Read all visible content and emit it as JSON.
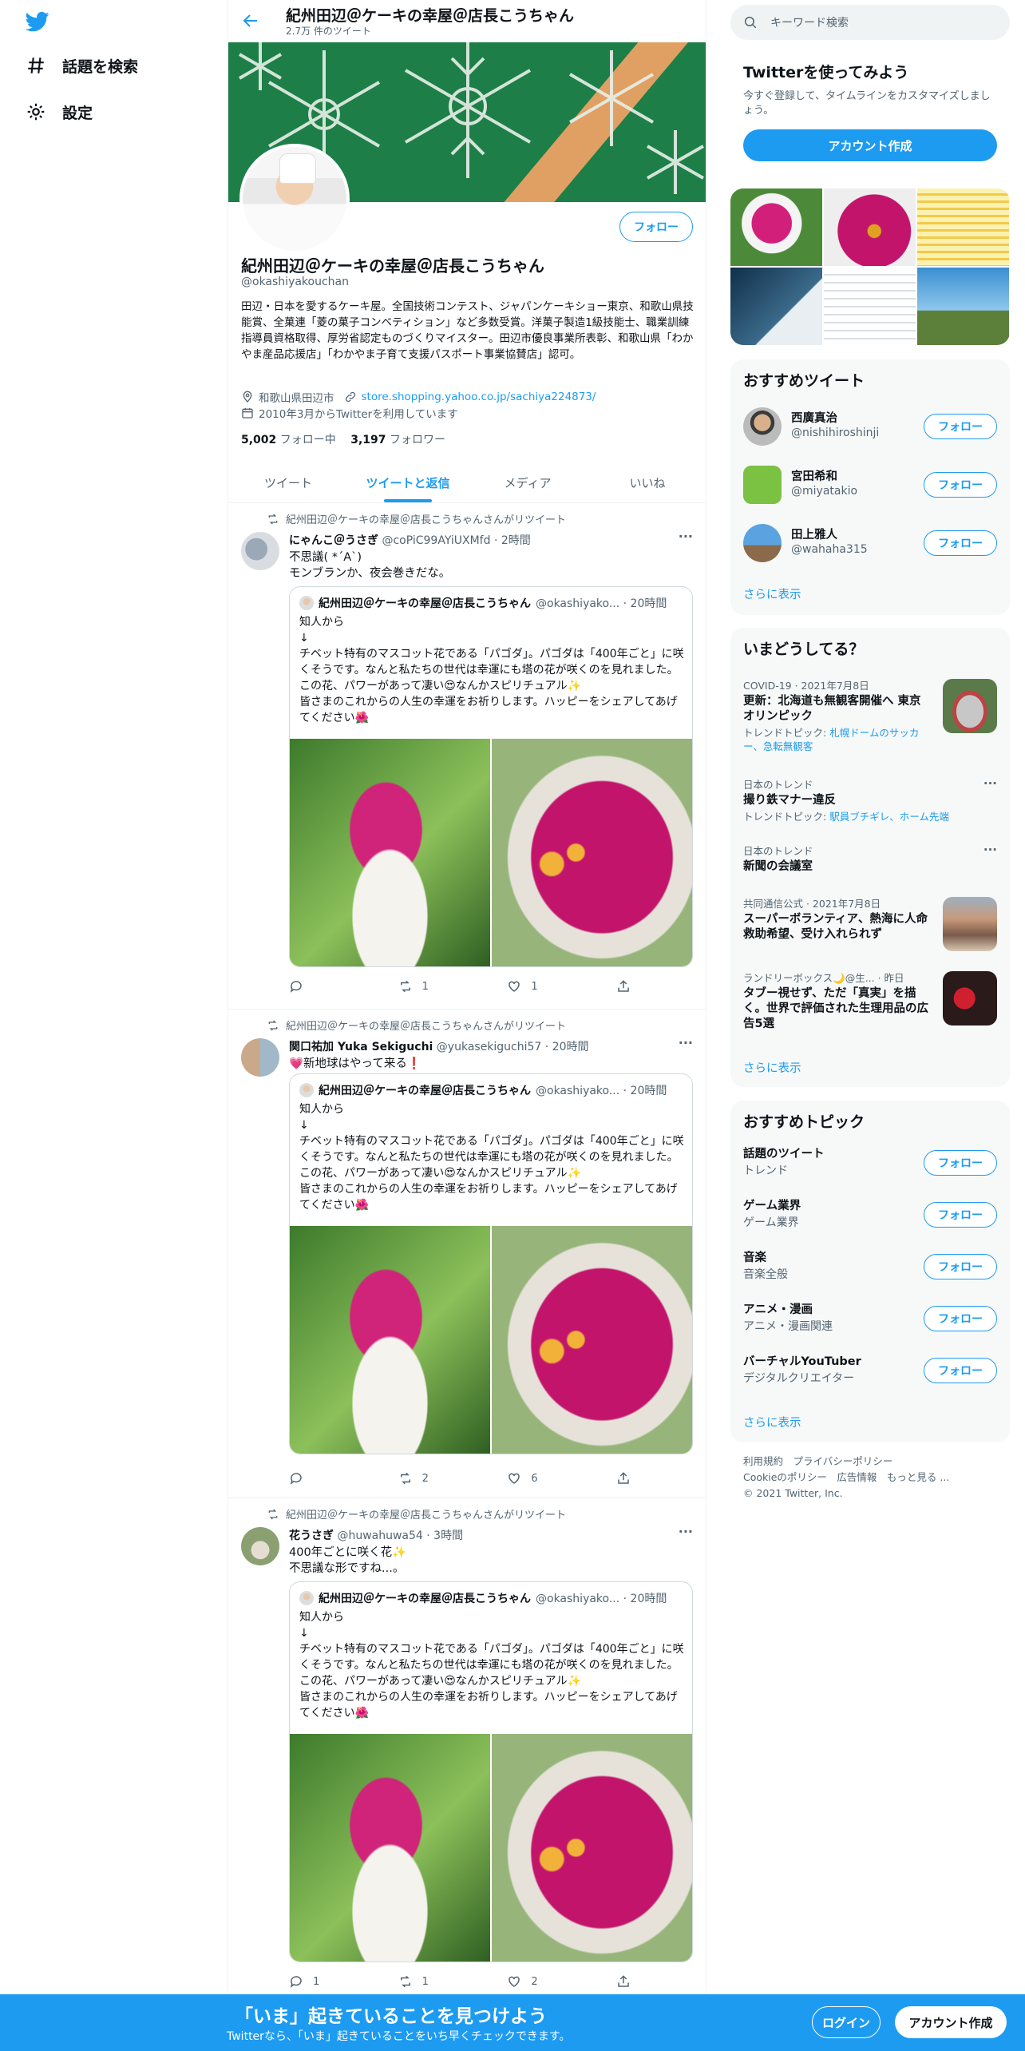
{
  "sidebar": {
    "items": [
      {
        "label": "話題を検索",
        "icon": "hashtag-icon"
      },
      {
        "label": "設定",
        "icon": "gear-icon"
      }
    ]
  },
  "header": {
    "title": "紀州田辺＠ケーキの幸屋＠店長こうちゃん",
    "subtitle": "2.7万 件のツイート"
  },
  "profile": {
    "follow_label": "フォロー",
    "name": "紀州田辺＠ケーキの幸屋＠店長こうちゃん",
    "handle": "@okashiyakouchan",
    "bio": "田辺・日本を愛するケーキ屋。全国技術コンテスト、ジャパンケーキショー東京、和歌山県技能賞、全菓連「菱の菓子コンベティション」など多数受賞。洋菓子製造1級技能士、職業訓練指導員資格取得、厚労省認定ものづくりマイスター。田辺市優良事業所表彰、和歌山県「わかやま産品応援店」「わかやま子育て支援パスポート事業協賛店」認可。",
    "location": "和歌山県田辺市",
    "url": "store.shopping.yahoo.co.jp/sachiya224873/",
    "joined": "2010年3月からTwitterを利用しています",
    "following_count": "5,002",
    "following_label": "フォロー中",
    "followers_count": "3,197",
    "followers_label": "フォロワー"
  },
  "tabs": [
    {
      "label": "ツイート"
    },
    {
      "label": "ツイートと返信"
    },
    {
      "label": "メディア"
    },
    {
      "label": "いいね"
    }
  ],
  "tweets": [
    {
      "retweet_line": "紀州田辺＠ケーキの幸屋＠店長こうちゃんさんがリツイート",
      "name": "にゃんこ＠うさぎ",
      "meta": "@coPiC99AYiUXMfd · 2時間",
      "text": "不思議( *´A`)\nモンブランか、夜会巻きだな。",
      "quote_name": "紀州田辺＠ケーキの幸屋＠店長こうちゃん",
      "quote_meta": "@okashiyako... · 20時間",
      "quote_text": "知人から\n↓\nチベット特有のマスコット花である「パゴダ」。パゴダは「400年ごと」に咲くそうです。なんと私たちの世代は幸運にも塔の花が咲くのを見れました。この花、パワーがあって凄い😍なんかスピリチュアル✨\n皆さまのこれからの人生の幸運をお祈りします。ハッピーをシェアしてあげてください🌺",
      "reply": "",
      "retweets": "1",
      "likes": "1"
    },
    {
      "retweet_line": "紀州田辺＠ケーキの幸屋＠店長こうちゃんさんがリツイート",
      "name": "関口祐加 Yuka Sekiguchi",
      "meta": "@yukasekiguchi57 · 20時間",
      "text": "💗新地球はやって来る❗",
      "quote_name": "紀州田辺＠ケーキの幸屋＠店長こうちゃん",
      "quote_meta": "@okashiyako... · 20時間",
      "quote_text": "知人から\n↓\nチベット特有のマスコット花である「パゴダ」。パゴダは「400年ごと」に咲くそうです。なんと私たちの世代は幸運にも塔の花が咲くのを見れました。この花、パワーがあって凄い😍なんかスピリチュアル✨\n皆さまのこれからの人生の幸運をお祈りします。ハッピーをシェアしてあげてください🌺",
      "reply": "",
      "retweets": "2",
      "likes": "6"
    },
    {
      "retweet_line": "紀州田辺＠ケーキの幸屋＠店長こうちゃんさんがリツイート",
      "name": "花うさぎ",
      "meta": "@huwahuwa54 · 3時間",
      "text": "400年ごとに咲く花✨\n不思議な形ですね...。",
      "quote_name": "紀州田辺＠ケーキの幸屋＠店長こうちゃん",
      "quote_meta": "@okashiyako... · 20時間",
      "quote_text": "知人から\n↓\nチベット特有のマスコット花である「パゴダ」。パゴダは「400年ごと」に咲くそうです。なんと私たちの世代は幸運にも塔の花が咲くのを見れました。この花、パワーがあって凄い😍なんかスピリチュアル✨\n皆さまのこれからの人生の幸運をお祈りします。ハッピーをシェアしてあげてください🌺",
      "reply": "1",
      "retweets": "1",
      "likes": "2"
    }
  ],
  "right": {
    "search_placeholder": "キーワード検索",
    "signup": {
      "title": "Twitterを使ってみよう",
      "text": "今すぐ登録して、タイムラインをカスタマイズしましょう。",
      "button": "アカウント作成"
    },
    "recommend_title": "おすすめツイート",
    "users": [
      {
        "name": "西廣真治",
        "handle": "@nishihiroshinji",
        "button": "フォロー"
      },
      {
        "name": "宮田希和",
        "handle": "@miyatakio",
        "button": "フォロー"
      },
      {
        "name": "田上雅人",
        "handle": "@wahaha315",
        "button": "フォロー"
      }
    ],
    "show_more": "さらに表示",
    "trends_title": "いまどうしてる？",
    "trends": [
      {
        "context": "COVID-19 · 2021年7月8日",
        "title": "更新：北海道も無観客開催へ 東京オリンピック",
        "sub_label": "トレンドトピック:",
        "sub_links": "札幌ドームのサッカー、急転無観客"
      },
      {
        "context": "日本のトレンド",
        "title": "撮り鉄マナー違反",
        "sub_label": "トレンドトピック:",
        "sub_links": "駅員ブチギレ、ホーム先端"
      },
      {
        "context": "日本のトレンド",
        "title": "新聞の会議室",
        "sub_label": "",
        "sub_links": ""
      },
      {
        "context": "共同通信公式 · 2021年7月8日",
        "title": "スーパーボランティア、熱海に人命救助希望、受け入れられず",
        "sub_label": "",
        "sub_links": ""
      },
      {
        "context": "ランドリーボックス🌙@生... · 昨日",
        "title": "タブー視せず、ただ「真実」を描く。世界で評価された生理用品の広告5選",
        "sub_label": "",
        "sub_links": ""
      }
    ],
    "topics_title": "おすすめトピック",
    "topics": [
      {
        "name": "話題のツイート",
        "category": "トレンド",
        "button": "フォロー"
      },
      {
        "name": "ゲーム業界",
        "category": "ゲーム業界",
        "button": "フォロー"
      },
      {
        "name": "音楽",
        "category": "音楽全般",
        "button": "フォロー"
      },
      {
        "name": "アニメ・漫画",
        "category": "アニメ・漫画関連",
        "button": "フォロー"
      },
      {
        "name": "バーチャルYouTuber",
        "category": "デジタルクリエイター",
        "button": "フォロー"
      }
    ],
    "footer": {
      "line1": "利用規約　プライバシーポリシー",
      "line2": "Cookieのポリシー　広告情報　もっと見る ...",
      "line3": "© 2021 Twitter, Inc."
    }
  },
  "bottom_bar": {
    "title": "「いま」起きていることを見つけよう",
    "subtitle": "Twitterなら、「いま」起きていることをいち早くチェックできます。",
    "login": "ログイン",
    "signup": "アカウント作成"
  },
  "colors": {
    "accent": "#1d9bf0",
    "text": "#0f1419",
    "muted": "#536471",
    "panel": "#f7f9f9"
  }
}
